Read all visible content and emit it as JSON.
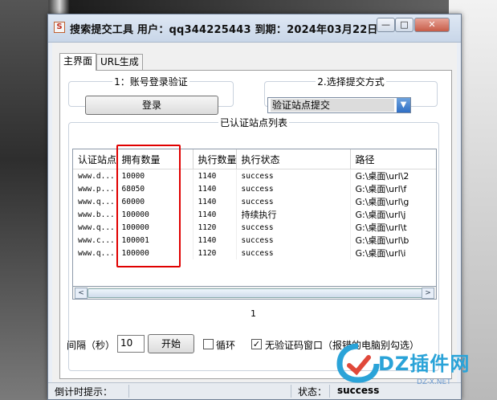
{
  "window": {
    "title": "搜索提交工具 用户：qq344225443 到期：2024年03月22日",
    "app_icon_glyph": "S",
    "minimize_glyph": "—",
    "maximize_glyph": "□",
    "close_glyph": "✕"
  },
  "tabs": [
    {
      "label": "主界面"
    },
    {
      "label": "URL生成"
    }
  ],
  "login_group": {
    "legend": "1：账号登录验证",
    "button": "登录"
  },
  "submit_group": {
    "legend": "2.选择提交方式",
    "selected": "验证站点提交"
  },
  "sites_group": {
    "legend": "已认证站点列表",
    "columns": [
      "认证站点",
      "拥有数量",
      "执行数量",
      "执行状态",
      "路径"
    ],
    "rows": [
      [
        "www.d...",
        "10000",
        "1140",
        "success",
        "G:\\桌面\\url\\2"
      ],
      [
        "www.p...",
        "68050",
        "1140",
        "success",
        "G:\\桌面\\url\\f"
      ],
      [
        "www.q...",
        "60000",
        "1140",
        "success",
        "G:\\桌面\\url\\g"
      ],
      [
        "www.b...",
        "100000",
        "1140",
        "持续执行",
        "G:\\桌面\\url\\j"
      ],
      [
        "www.q...",
        "100000",
        "1120",
        "success",
        "G:\\桌面\\url\\t"
      ],
      [
        "www.c...",
        "100001",
        "1140",
        "success",
        "G:\\桌面\\url\\b"
      ],
      [
        "www.q...",
        "100000",
        "1120",
        "success",
        "G:\\桌面\\url\\i"
      ]
    ],
    "page_number": "1",
    "scroll_left": "<",
    "scroll_right": ">"
  },
  "controls": {
    "interval_label": "间隔（秒）",
    "interval_value": "10",
    "start_button": "开始",
    "loop_label": "循环",
    "loop_checked": false,
    "no_captcha_label": "无验证码窗口（报错的电脑别勾选）",
    "no_captcha_checked": true,
    "check_glyph": "✓"
  },
  "statusbar": {
    "countdown_label": "倒计时提示：",
    "status_label": "状态：",
    "status_value": "success"
  },
  "watermark": {
    "text": "DZ插件网",
    "sub": "DZ-X.NET"
  },
  "colors": {
    "highlight": "#e00000",
    "accent": "#2aa3d8"
  }
}
